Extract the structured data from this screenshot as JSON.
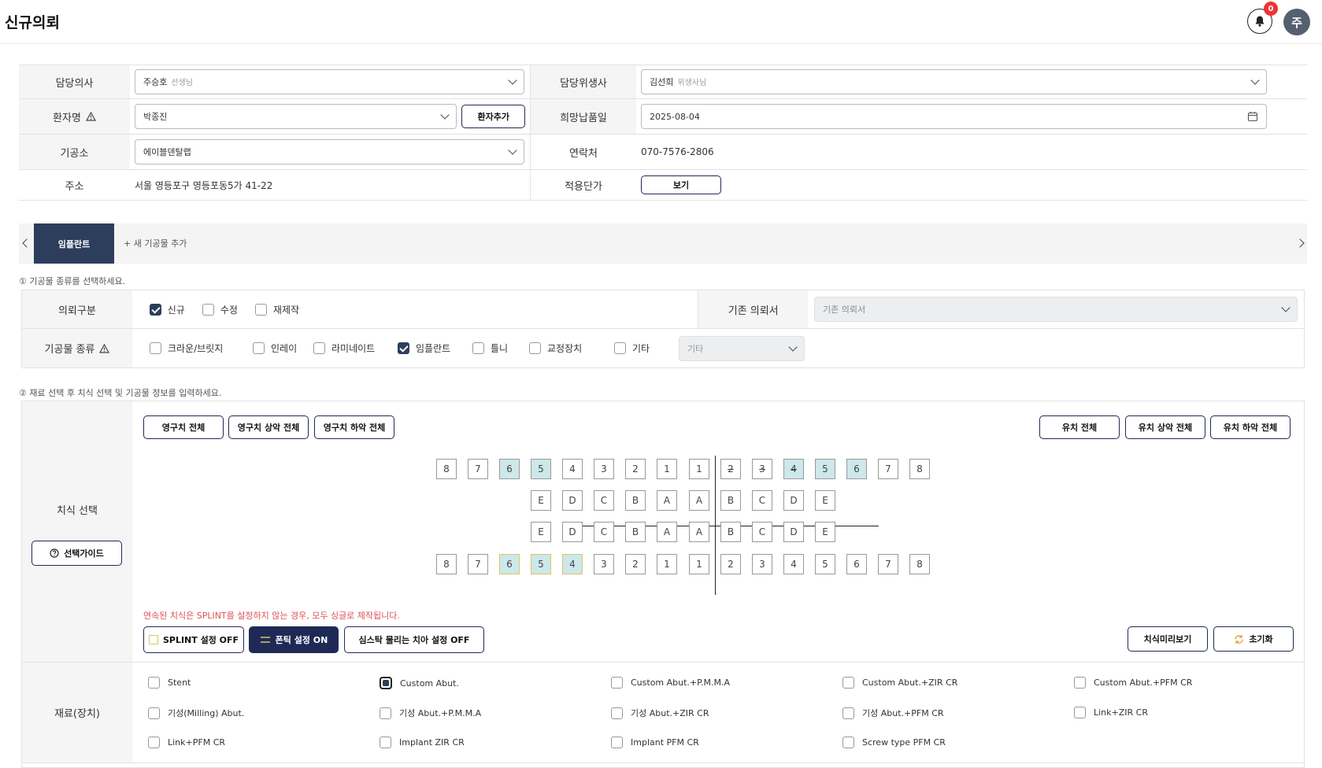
{
  "header": {
    "title": "신규의뢰",
    "notification_count": "0",
    "avatar_initial": "주"
  },
  "info": {
    "doctor_label": "담당의사",
    "doctor_value": "주승호",
    "doctor_sub": "선생님",
    "hygienist_label": "담당위생사",
    "hygienist_value": "김선희",
    "hygienist_sub": "위생사님",
    "patient_label": "환자명",
    "patient_value": "박종진",
    "add_patient_label": "환자추가",
    "due_label": "희망납품일",
    "due_value": "2025-08-04",
    "lab_label": "기공소",
    "lab_value": "에이블덴탈랩",
    "contact_label": "연락처",
    "contact_value": "070-7576-2806",
    "address_label": "주소",
    "address_value": "서울 영등포구 영등포동5가 41-22",
    "price_label": "적용단가",
    "price_button": "보기"
  },
  "tabs": {
    "active": "임플란트",
    "add": "+ 새 기공물 추가"
  },
  "step1_hint": "① 기공물 종류를 선택하세요.",
  "request_type": {
    "label": "의뢰구분",
    "options": [
      {
        "label": "신규",
        "checked": true
      },
      {
        "label": "수정",
        "checked": false
      },
      {
        "label": "재제작",
        "checked": false
      }
    ],
    "existing_label": "기존 의뢰서",
    "existing_placeholder": "기존 의뢰서"
  },
  "prosthesis_type": {
    "label": "기공물 종류",
    "options": [
      {
        "label": "크라운/브릿지",
        "checked": false
      },
      {
        "label": "인레이",
        "checked": false
      },
      {
        "label": "라미네이트",
        "checked": false
      },
      {
        "label": "임플란트",
        "checked": true
      },
      {
        "label": "틀니",
        "checked": false
      },
      {
        "label": "교정장치",
        "checked": false
      },
      {
        "label": "기타",
        "checked": false
      }
    ],
    "other_placeholder": "기타"
  },
  "step2_hint": "② 재료 선택 후 치식 선택 및 기공물 정보를 입력하세요.",
  "tooth_section": {
    "label": "치식 선택",
    "guide_button": "선택가이드",
    "perm_all": "영구치 전체",
    "perm_upper": "영구치 상악 전체",
    "perm_lower": "영구치 하악 전체",
    "prim_all": "유치 전체",
    "prim_upper": "유치 상악 전체",
    "prim_lower": "유치 하악 전체",
    "upper_perm": [
      "8",
      "7",
      "6",
      "5",
      "4",
      "3",
      "2",
      "1",
      "1",
      "2",
      "3",
      "4",
      "5",
      "6",
      "7",
      "8"
    ],
    "upper_prim": [
      "E",
      "D",
      "C",
      "B",
      "A",
      "A",
      "B",
      "C",
      "D",
      "E"
    ],
    "lower_prim": [
      "E",
      "D",
      "C",
      "B",
      "A",
      "A",
      "B",
      "C",
      "D",
      "E"
    ],
    "lower_perm": [
      "8",
      "7",
      "6",
      "5",
      "4",
      "3",
      "2",
      "1",
      "1",
      "2",
      "3",
      "4",
      "5",
      "6",
      "7",
      "8"
    ],
    "warning": "연속된 치식은 SPLINT를 설정하지 않는 경우, 모두 싱글로 제작됩니다.",
    "splint_button": "SPLINT 설정 OFF",
    "pontic_button": "폰틱 설정 ON",
    "deep_button": "심스탁 물리는 치아 설정 OFF",
    "preview_button": "치식미리보기",
    "reset_button": "초기화"
  },
  "materials": {
    "label": "재료(장치)",
    "items": [
      {
        "label": "Stent",
        "checked": false
      },
      {
        "label": "Custom Abut.",
        "checked": true
      },
      {
        "label": "Custom Abut.+P.M.M.A",
        "checked": false
      },
      {
        "label": "Custom Abut.+ZIR CR",
        "checked": false
      },
      {
        "label": "Custom Abut.+PFM CR",
        "checked": false
      },
      {
        "label": "기성(Milling) Abut.",
        "checked": false
      },
      {
        "label": "기성 Abut.+P.M.M.A",
        "checked": false
      },
      {
        "label": "기성 Abut.+ZIR CR",
        "checked": false
      },
      {
        "label": "기성 Abut.+PFM CR",
        "checked": false
      },
      {
        "label": "Link+ZIR CR",
        "checked": false
      },
      {
        "label": "Link+PFM CR",
        "checked": false
      },
      {
        "label": "Implant ZIR CR",
        "checked": false
      },
      {
        "label": "Implant PFM CR",
        "checked": false
      },
      {
        "label": "Screw type PFM CR",
        "checked": false
      }
    ]
  },
  "colors": {
    "primary": "#2c3e5c",
    "accent": "#1e2a55",
    "selected_tooth": "#cce8ea",
    "warning": "#e05050"
  }
}
